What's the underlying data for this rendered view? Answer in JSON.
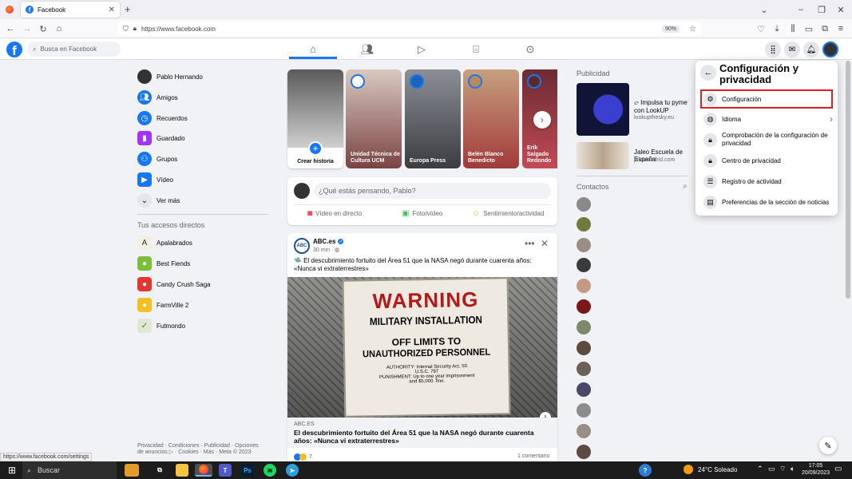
{
  "browser": {
    "tab_title": "Facebook",
    "new_tab": "+",
    "url": "https://www.facebook.com",
    "zoom": "90%",
    "status_url": "https://www.facebook.com/settings"
  },
  "fb": {
    "search_placeholder": "Busca en Facebook"
  },
  "sidebar": {
    "items": [
      {
        "label": "Pablo Hernando",
        "icon": "avatar"
      },
      {
        "label": "Amigos",
        "icon": "friends-icon"
      },
      {
        "label": "Recuerdos",
        "icon": "clock-icon"
      },
      {
        "label": "Guardado",
        "icon": "bookmark-icon"
      },
      {
        "label": "Grupos",
        "icon": "groups-icon"
      },
      {
        "label": "Vídeo",
        "icon": "video-icon"
      },
      {
        "label": "Ver más",
        "icon": "chevron-down-icon"
      }
    ],
    "shortcuts_title": "Tus accesos directos",
    "shortcuts": [
      "Apalabrados",
      "Best Fiends",
      "Candy Crush Saga",
      "FarmVille 2",
      "Futmondo"
    ],
    "footer": "Privacidad · Condiciones · Publicidad · Opciones de anuncios ▷ · Cookies · Más · Meta © 2023"
  },
  "stories": [
    {
      "label": "Crear historia"
    },
    {
      "label": "Unidad Técnica de Cultura UCM"
    },
    {
      "label": "Europa Press"
    },
    {
      "label": "Belén Blanco Benedicto"
    },
    {
      "label": "Erik Salgado Redondo"
    }
  ],
  "composer": {
    "placeholder": "¿Qué estás pensando, Pablo?",
    "actions": [
      "Vídeo en directo",
      "Foto/vídeo",
      "Sentimiento/actividad"
    ]
  },
  "post": {
    "author": "ABC.es",
    "time": "30 min · ",
    "text": "🛸 El descubrimiento fortuito del Área 51 que la NASA negó durante cuarenta años: «Nunca vi extraterrestres»",
    "image_sign": {
      "line1": "WARNING",
      "line2": "MILITARY INSTALLATION",
      "line3": "OFF LIMITS TO",
      "line4": "UNAUTHORIZED PERSONNEL",
      "line5": "AUTHORITY: Internal Security Act, 50",
      "line6": "U.S.C. 797",
      "line7": "PUNISHMENT: Up to one year imprisonment",
      "line8": "and $5,000. fine."
    },
    "link_domain": "ABC.ES",
    "link_title": "El descubrimiento fortuito del Área 51 que la NASA negó durante cuarenta años: «Nunca vi extraterrestres»",
    "reactions": "7",
    "comments": "1 comentario"
  },
  "right": {
    "ads_title": "Publicidad",
    "ads": [
      {
        "title": "Impulsa tu pyme con LookUP",
        "domain": "lookupthesky.eu"
      },
      {
        "title": "Jaleo Escuela de España",
        "domain": "jaleomadrid.com"
      }
    ],
    "contacts_title": "Contactos"
  },
  "menu": {
    "title": "Configuración y privacidad",
    "items": [
      {
        "label": "Configuración",
        "icon": "gear-icon"
      },
      {
        "label": "Idioma",
        "icon": "globe-icon"
      },
      {
        "label": "Comprobación de la configuración de privacidad",
        "icon": "lock-check-icon"
      },
      {
        "label": "Centro de privacidad",
        "icon": "lock-icon"
      },
      {
        "label": "Registro de actividad",
        "icon": "list-icon"
      },
      {
        "label": "Preferencias de la sección de noticias",
        "icon": "feed-icon"
      }
    ],
    "highlight_color": "#e41e1e"
  },
  "taskbar": {
    "search": "Buscar",
    "weather": "24°C  Soleado",
    "time": "17:05",
    "date": "20/09/2023"
  },
  "colors": {
    "brand": "#1877f2"
  }
}
